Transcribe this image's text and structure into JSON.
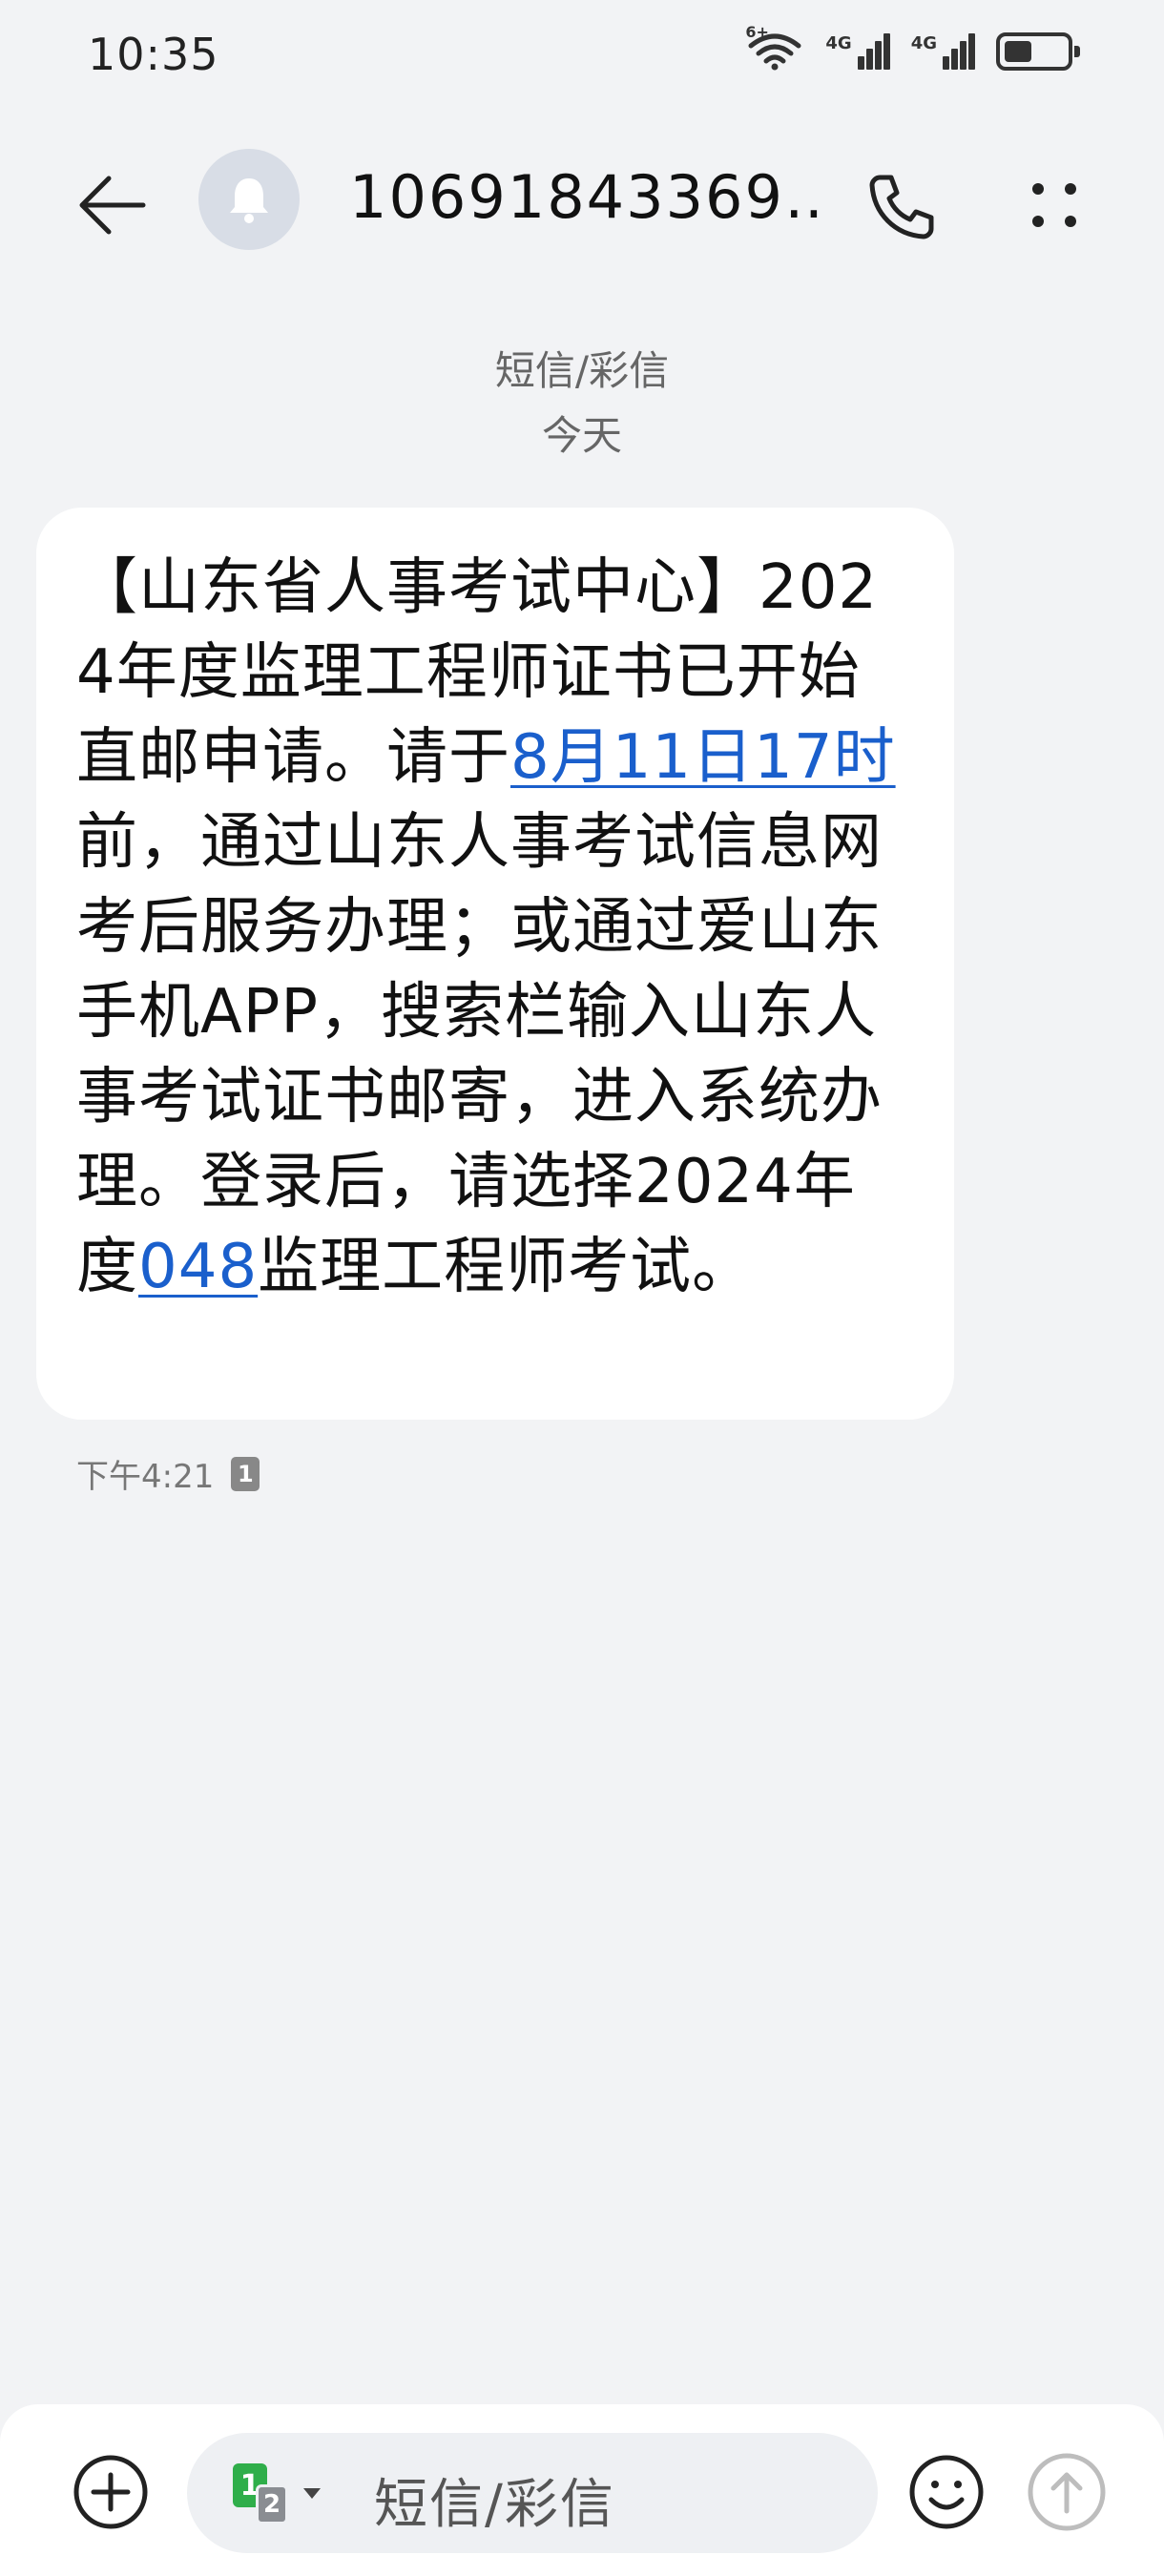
{
  "status_bar": {
    "time": "10:35",
    "wifi_label": "6+",
    "signal_1_label": "4G",
    "signal_2_label": "4G",
    "battery_percent": 45
  },
  "header": {
    "title": "10691843369…",
    "avatar_icon": "bell-icon"
  },
  "meta": {
    "message_type": "短信/彩信",
    "day": "今天"
  },
  "message": {
    "text_before_date": "【山东省人事考试中心】2024年度监理工程师证书已开始直邮申请。请于",
    "date_link": "8月11日17时",
    "text_middle": "前，通过山东人事考试信息网考后服务办理；或通过爱山东手机APP，搜索栏输入山东人事考试证书邮寄，进入系统办理。登录后，请选择2024年度",
    "code_link": "048",
    "text_after": "监理工程师考试。",
    "timestamp": "下午4:21",
    "sim": "1"
  },
  "input": {
    "placeholder": "短信/彩信",
    "sim_primary": "1",
    "sim_secondary": "2"
  },
  "colors": {
    "background": "#f2f3f5",
    "bubble": "#ffffff",
    "link": "#1a5fcc",
    "sim_green": "#2fae4a"
  }
}
